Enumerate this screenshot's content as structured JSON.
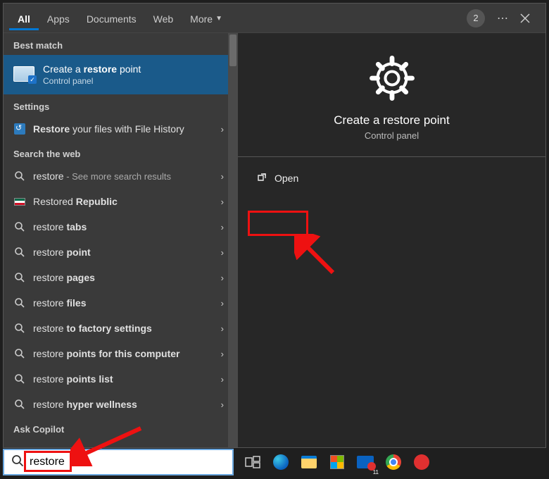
{
  "tabs": {
    "all": "All",
    "apps": "Apps",
    "documents": "Documents",
    "web": "Web",
    "more": "More"
  },
  "header": {
    "count": "2"
  },
  "sections": {
    "best_match": "Best match",
    "settings": "Settings",
    "search_web": "Search the web",
    "ask_copilot": "Ask Copilot"
  },
  "best_match": {
    "title_prefix": "Create a ",
    "title_strong": "restore",
    "title_suffix": " point",
    "subtitle": "Control panel"
  },
  "settings_items": [
    {
      "prefix": "Restore",
      "rest": " your files with File History"
    }
  ],
  "web_items": [
    {
      "prefix": "restore",
      "rest": "",
      "extra": " - See more search results",
      "icon": "search"
    },
    {
      "prefix": "Restore",
      "suffix_plain": "d ",
      "suffix_bold": "Republic",
      "icon": "flag"
    },
    {
      "prefix": "restore",
      "suffix_bold": " tabs",
      "icon": "search"
    },
    {
      "prefix": "restore",
      "suffix_bold": " point",
      "icon": "search"
    },
    {
      "prefix": "restore",
      "suffix_bold": " pages",
      "icon": "search"
    },
    {
      "prefix": "restore",
      "suffix_bold": " files",
      "icon": "search"
    },
    {
      "prefix": "restore",
      "suffix_bold": " to factory settings",
      "icon": "search"
    },
    {
      "prefix": "restore",
      "suffix_bold": " points for this computer",
      "icon": "search"
    },
    {
      "prefix": "restore",
      "suffix_bold": " points list",
      "icon": "search"
    },
    {
      "prefix": "restore",
      "suffix_bold": " hyper wellness",
      "icon": "search"
    }
  ],
  "preview": {
    "title": "Create a restore point",
    "subtitle": "Control panel",
    "open": "Open"
  },
  "search": {
    "value": "restore"
  },
  "mail_badge": "11"
}
